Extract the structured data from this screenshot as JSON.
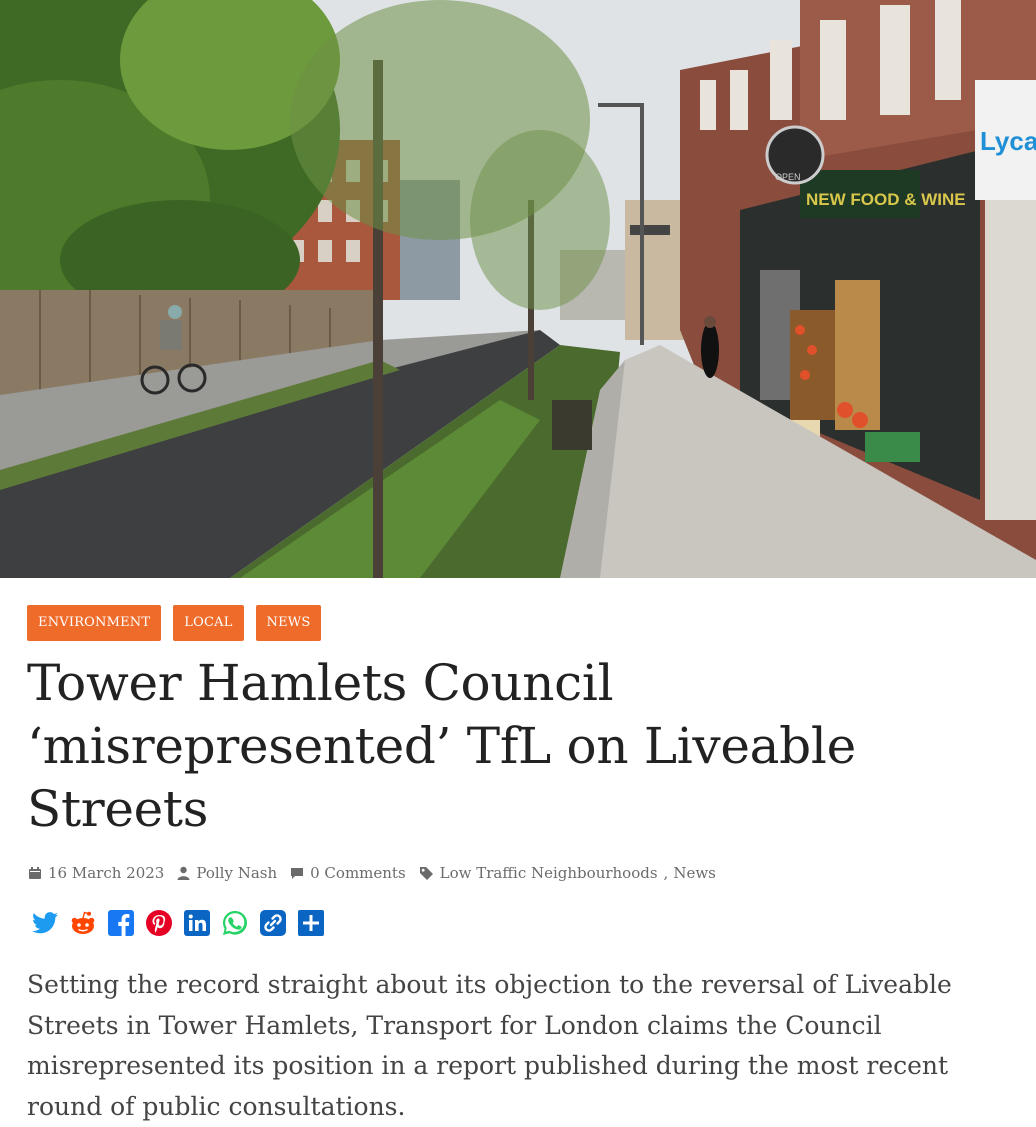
{
  "hero": {
    "sign_lycamobile": "Lycar",
    "sign_shop": "NEW FOOD & WINE",
    "sign_offlicence": "OPEN"
  },
  "categories": [
    "ENVIRONMENT",
    "LOCAL",
    "NEWS"
  ],
  "article": {
    "title": "Tower Hamlets Council ‘misrepresented’ TfL on Liveable Streets",
    "date": "16 March 2023",
    "author": "Polly Nash",
    "comments": "0 Comments",
    "tags": [
      "Low Traffic Neighbourhoods",
      "News"
    ],
    "tag_separator": ",",
    "lead": "Setting the record straight about its objection to the reversal of Liveable Streets in Tower Hamlets, Transport for London claims the Council misrepresented its position in a report published during the most recent round of public consultations."
  },
  "share_icons": [
    "twitter-icon",
    "reddit-icon",
    "facebook-icon",
    "pinterest-icon",
    "linkedin-icon",
    "whatsapp-icon",
    "copy-link-icon",
    "share-plus-icon"
  ],
  "colors": {
    "accent": "#ef6b2a",
    "share_blue": "#0a66c2"
  }
}
